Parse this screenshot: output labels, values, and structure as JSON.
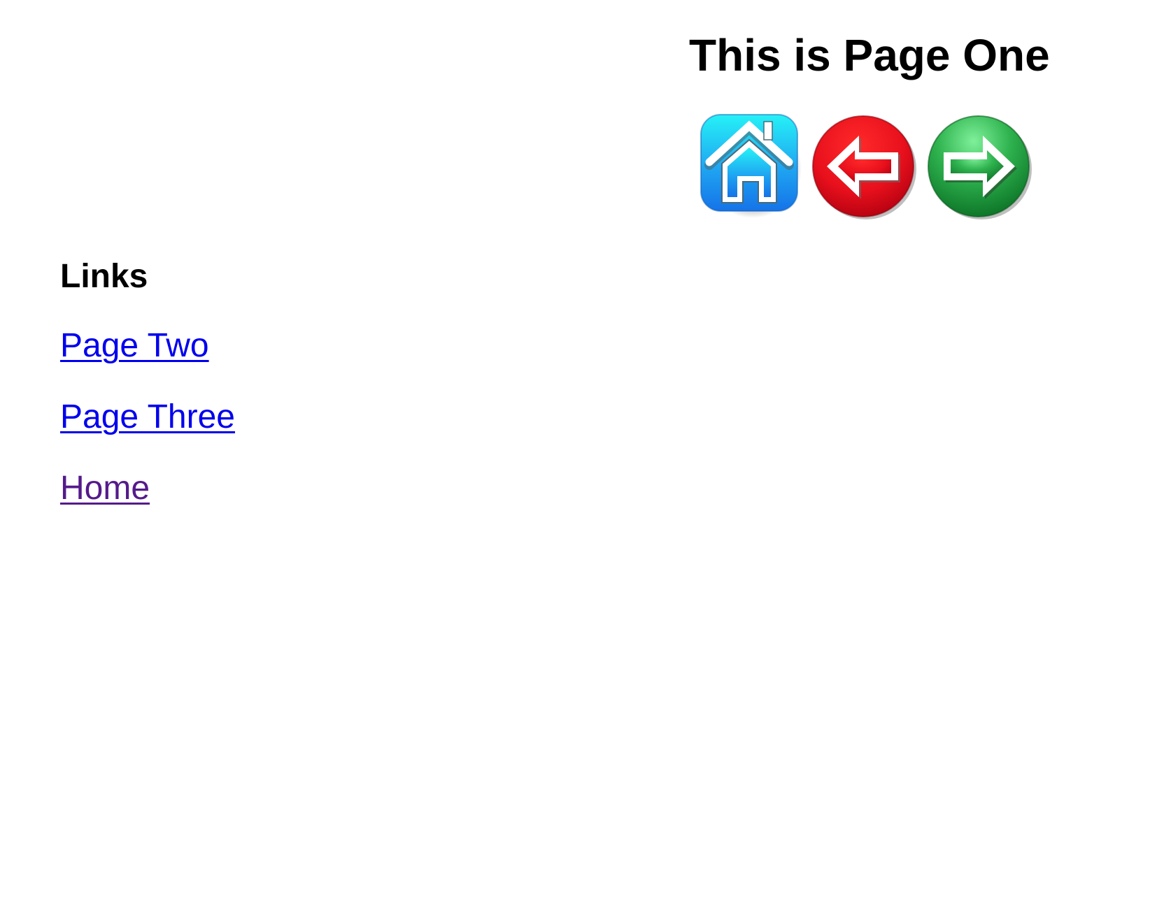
{
  "header": {
    "title": "This is Page One"
  },
  "nav_icons": [
    {
      "icon": "home-icon",
      "color": "#1e9bf0"
    },
    {
      "icon": "back-arrow-icon",
      "color": "#e8101c"
    },
    {
      "icon": "forward-arrow-icon",
      "color": "#1f9a3c"
    }
  ],
  "links_section": {
    "heading": "Links",
    "items": [
      {
        "label": "Page Two",
        "color": "#0000ee"
      },
      {
        "label": "Page Three",
        "color": "#0000ee"
      },
      {
        "label": "Home",
        "color": "#551a8b"
      }
    ]
  }
}
